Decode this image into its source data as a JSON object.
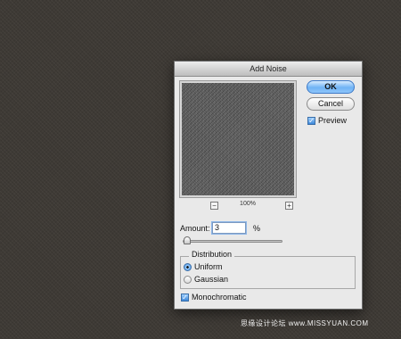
{
  "dialog": {
    "title": "Add Noise",
    "ok_label": "OK",
    "cancel_label": "Cancel",
    "preview": {
      "label": "Preview",
      "checked": true
    },
    "zoom": {
      "level": "100%",
      "minus": "−",
      "plus": "+"
    },
    "amount": {
      "label": "Amount:",
      "value": "3",
      "unit": "%",
      "slider_fraction": 0.008
    },
    "distribution": {
      "title": "Distribution",
      "options": [
        {
          "label": "Uniform",
          "selected": true
        },
        {
          "label": "Gaussian",
          "selected": false
        }
      ]
    },
    "monochromatic": {
      "label": "Monochromatic",
      "checked": true
    },
    "check_glyph": "✓"
  },
  "watermark": {
    "text": "思缘设计论坛 www.MISSYUAN.COM"
  },
  "colors": {
    "background": "#3e3a35",
    "dialog": "#e9e9e9",
    "accent_blue": "#6fb3f5"
  }
}
